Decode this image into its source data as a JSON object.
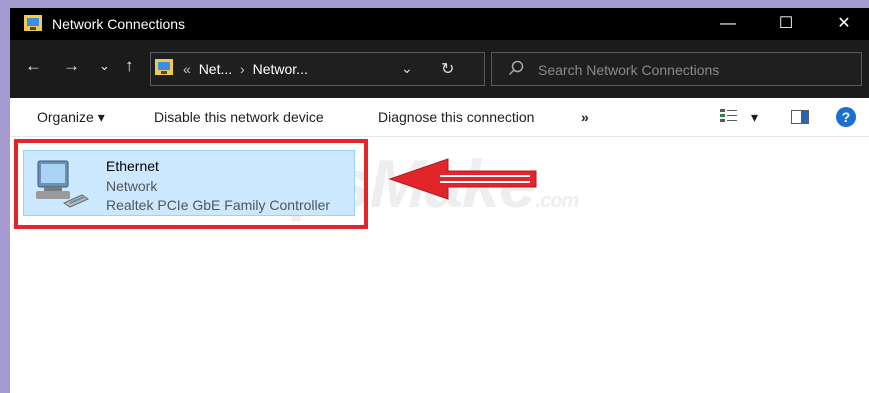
{
  "window": {
    "title": "Network Connections",
    "controls": {
      "minimize": "—",
      "maximize": "☐",
      "close": "✕"
    }
  },
  "nav": {
    "back": "←",
    "forward": "→",
    "recent": "⌄",
    "up": "↑"
  },
  "address": {
    "overflow": "«",
    "crumbs": [
      "Net...",
      "Networ..."
    ],
    "separator": "›",
    "dropdown": "⌄",
    "refresh": "↻"
  },
  "search": {
    "placeholder": "Search Network Connections"
  },
  "toolbar": {
    "organize": "Organize ▾",
    "disable": "Disable this network device",
    "diagnose": "Diagnose this connection",
    "more": "»",
    "view_dropdown": "▾",
    "help": "?"
  },
  "connection": {
    "name": "Ethernet",
    "status": "Network",
    "device": "Realtek PCIe GbE Family Controller"
  },
  "watermark": {
    "brand": "TipsMake",
    "suffix": ".com"
  },
  "colors": {
    "highlight": "#e0262a",
    "selection": "#cce8ff",
    "help_blue": "#1a6fd0"
  },
  "icons": [
    "network-connections-icon",
    "search-icon",
    "view-options-icon",
    "preview-pane-icon",
    "help-icon",
    "ethernet-icon",
    "red-arrow-icon"
  ]
}
